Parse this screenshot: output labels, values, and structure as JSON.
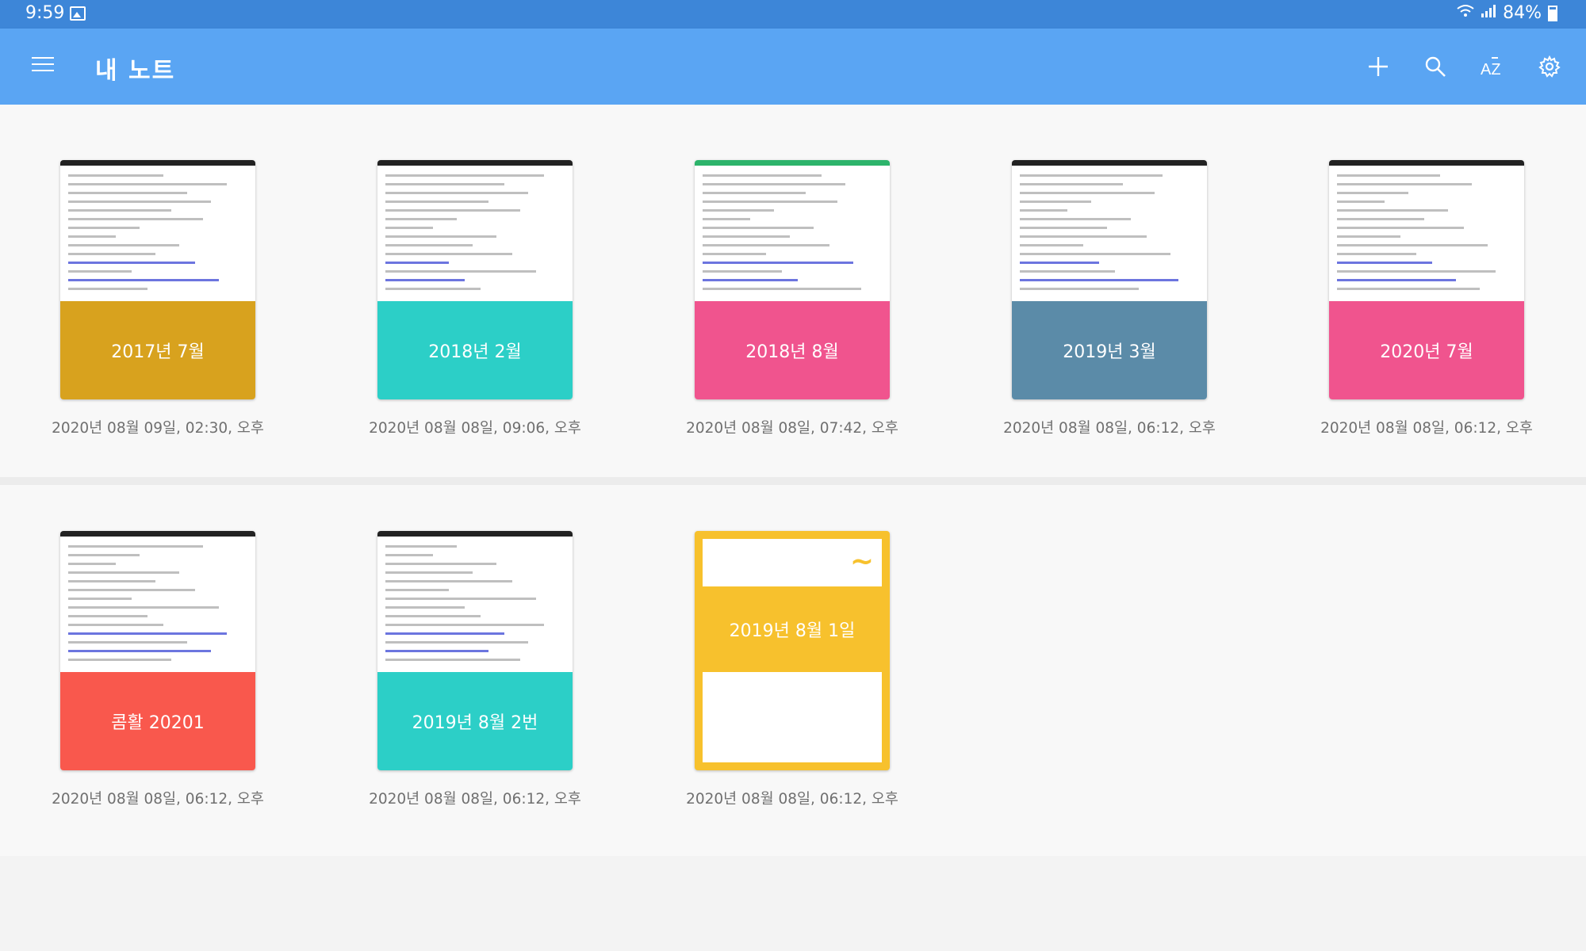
{
  "status_bar": {
    "time": "9:59",
    "battery": "84%"
  },
  "app_bar": {
    "title": "내 노트",
    "icons": [
      "menu-icon",
      "plus-icon",
      "search-icon",
      "sort-az-icon",
      "gear-icon"
    ]
  },
  "notes": [
    {
      "name": "2017년 7월",
      "date": "2020년 08월 09일, 02:30, 오후",
      "color": "#d8a21e"
    },
    {
      "name": "2018년 2월",
      "date": "2020년 08월 08일, 09:06, 오후",
      "color": "#2ccfc7"
    },
    {
      "name": "2018년 8월",
      "date": "2020년 08월 08일, 07:42, 오후",
      "color": "#f0548e"
    },
    {
      "name": "2019년 3월",
      "date": "2020년 08월 08일, 06:12, 오후",
      "color": "#5b8ba8"
    },
    {
      "name": "2020년 7월",
      "date": "2020년 08월 08일, 06:12, 오후",
      "color": "#f0548e"
    },
    {
      "name": "콤활 20201",
      "date": "2020년 08월 08일, 06:12, 오후",
      "color": "#f9584d"
    },
    {
      "name": "2019년 8월 2번",
      "date": "2020년 08월 08일, 06:12, 오후",
      "color": "#2ccfc7"
    },
    {
      "name": "2019년 8월 1일",
      "date": "2020년 08월 08일, 06:12, 오후",
      "color": "#f7c12d"
    }
  ]
}
